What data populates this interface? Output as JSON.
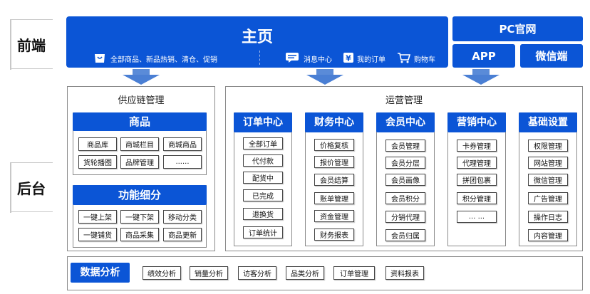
{
  "layers": {
    "frontend": "前端",
    "backend": "后台"
  },
  "home": {
    "title": "主页",
    "left_items": "全部商品、新品热销、清仓、促销",
    "right_items": [
      "消息中心",
      "我的订单",
      "购物车"
    ]
  },
  "pc_site": "PC官网",
  "app": "APP",
  "wechat": "微信端",
  "supply_chain": {
    "title": "供应链管理",
    "goods": {
      "title": "商品",
      "items": [
        "商品库",
        "商城栏目",
        "商城商品",
        "货轮播图",
        "品牌管理",
        "......"
      ]
    },
    "functions": {
      "title": "功能细分",
      "items": [
        "一键上架",
        "一键下架",
        "移动分类",
        "一键铺货",
        "商品采集",
        "商品更新"
      ]
    }
  },
  "operations": {
    "title": "运营管理",
    "columns": [
      {
        "title": "订单中心",
        "items": [
          "全部订单",
          "代付款",
          "配货中",
          "已完成",
          "退换货",
          "订单统计"
        ]
      },
      {
        "title": "财务中心",
        "items": [
          "价格复核",
          "报价管理",
          "会员结算",
          "账单管理",
          "资金管理",
          "财务报表"
        ]
      },
      {
        "title": "会员中心",
        "items": [
          "会员管理",
          "会员分层",
          "会员画像",
          "会员积分",
          "分销代理",
          "会员归属"
        ]
      },
      {
        "title": "营销中心",
        "items": [
          "卡券管理",
          "代理管理",
          "拼团包裹",
          "积分管理",
          "... ..."
        ]
      },
      {
        "title": "基础设置",
        "items": [
          "权限管理",
          "网站管理",
          "微信管理",
          "广告管理",
          "操作日志",
          "内容管理"
        ]
      }
    ]
  },
  "analytics": {
    "title": "数据分析",
    "items": [
      "绩效分析",
      "销量分析",
      "访客分析",
      "品类分析",
      "订单管理",
      "资料报表"
    ]
  },
  "colors": {
    "primary": "#0b55d6",
    "arrow": "#4a7fd4"
  }
}
